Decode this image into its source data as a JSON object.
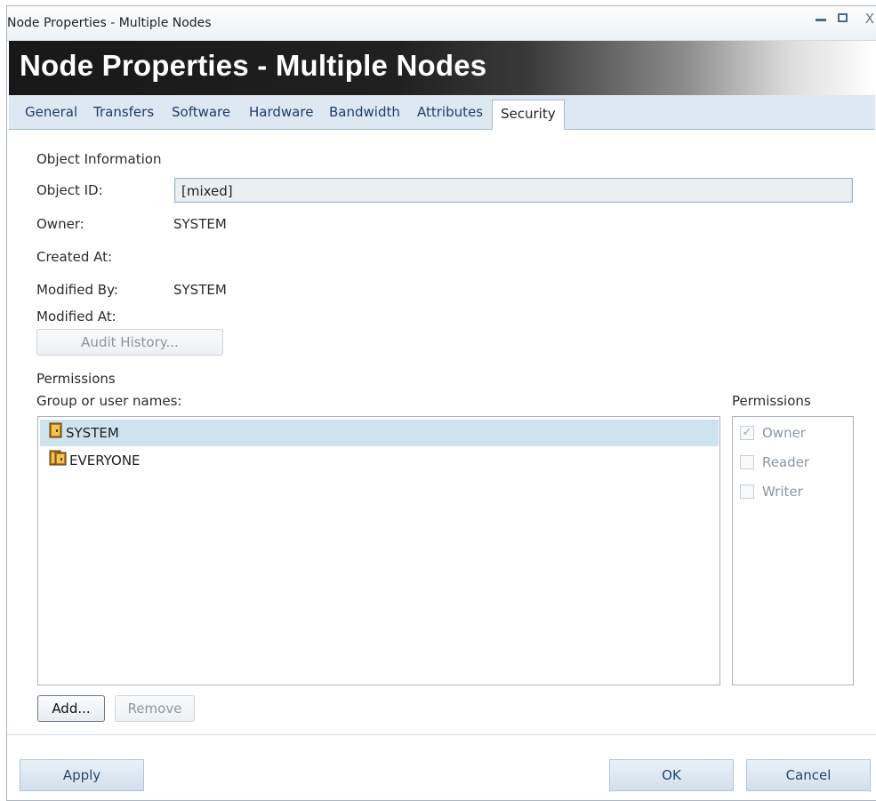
{
  "window": {
    "title": "Node Properties - Multiple Nodes",
    "controls": {
      "minimize": "minimize",
      "maximize": "maximize",
      "close": "X"
    }
  },
  "banner": {
    "title": "Node Properties - Multiple Nodes"
  },
  "tabs": [
    {
      "label": "General",
      "active": false
    },
    {
      "label": "Transfers",
      "active": false
    },
    {
      "label": "Software",
      "active": false
    },
    {
      "label": "Hardware",
      "active": false
    },
    {
      "label": "Bandwidth",
      "active": false
    },
    {
      "label": "Attributes",
      "active": false
    },
    {
      "label": "Security",
      "active": true
    }
  ],
  "object_info": {
    "section_label": "Object Information",
    "object_id_label": "Object ID:",
    "object_id_value": "[mixed]",
    "owner_label": "Owner:",
    "owner_value": "SYSTEM",
    "created_at_label": "Created At:",
    "modified_by_label": "Modified By:",
    "modified_by_value": "SYSTEM",
    "modified_at_label": "Modified At:",
    "audit_history_button": "Audit History..."
  },
  "permissions": {
    "section_label": "Permissions",
    "group_label": "Group or user names:",
    "perm_label": "Permissions",
    "users": [
      {
        "name": "SYSTEM",
        "selected": true
      },
      {
        "name": "EVERYONE",
        "selected": false
      }
    ],
    "options": [
      {
        "label": "Owner",
        "checked": true
      },
      {
        "label": "Reader",
        "checked": false
      },
      {
        "label": "Writer",
        "checked": false
      }
    ],
    "add_button": "Add...",
    "remove_button": "Remove"
  },
  "footer": {
    "apply_button": "Apply",
    "ok_button": "OK",
    "cancel_button": "Cancel"
  },
  "colors": {
    "tab_strip": "#dde8f3",
    "selected_row": "#cde3ee",
    "banner_dark": "#181818"
  }
}
